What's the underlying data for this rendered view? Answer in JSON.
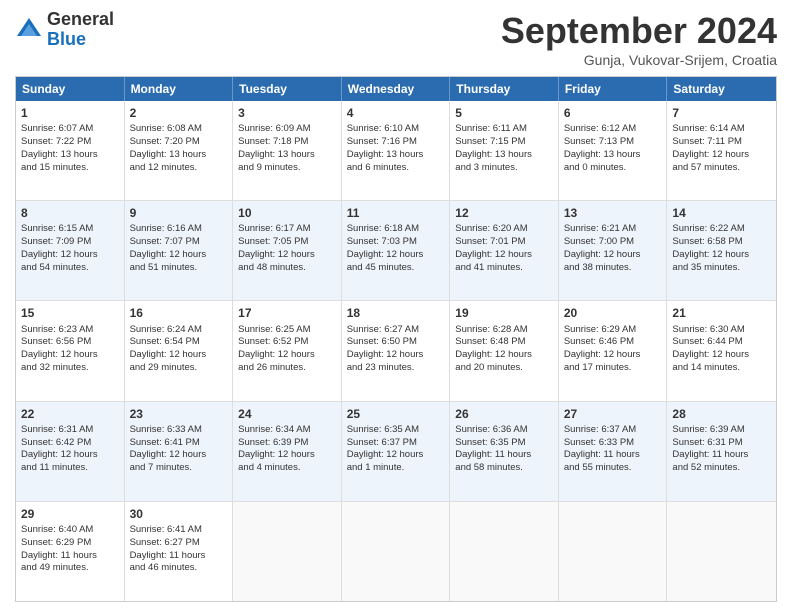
{
  "logo": {
    "general": "General",
    "blue": "Blue"
  },
  "title": "September 2024",
  "subtitle": "Gunja, Vukovar-Srijem, Croatia",
  "days": [
    "Sunday",
    "Monday",
    "Tuesday",
    "Wednesday",
    "Thursday",
    "Friday",
    "Saturday"
  ],
  "rows": [
    [
      {
        "day": "1",
        "lines": [
          "Sunrise: 6:07 AM",
          "Sunset: 7:22 PM",
          "Daylight: 13 hours",
          "and 15 minutes."
        ]
      },
      {
        "day": "2",
        "lines": [
          "Sunrise: 6:08 AM",
          "Sunset: 7:20 PM",
          "Daylight: 13 hours",
          "and 12 minutes."
        ]
      },
      {
        "day": "3",
        "lines": [
          "Sunrise: 6:09 AM",
          "Sunset: 7:18 PM",
          "Daylight: 13 hours",
          "and 9 minutes."
        ]
      },
      {
        "day": "4",
        "lines": [
          "Sunrise: 6:10 AM",
          "Sunset: 7:16 PM",
          "Daylight: 13 hours",
          "and 6 minutes."
        ]
      },
      {
        "day": "5",
        "lines": [
          "Sunrise: 6:11 AM",
          "Sunset: 7:15 PM",
          "Daylight: 13 hours",
          "and 3 minutes."
        ]
      },
      {
        "day": "6",
        "lines": [
          "Sunrise: 6:12 AM",
          "Sunset: 7:13 PM",
          "Daylight: 13 hours",
          "and 0 minutes."
        ]
      },
      {
        "day": "7",
        "lines": [
          "Sunrise: 6:14 AM",
          "Sunset: 7:11 PM",
          "Daylight: 12 hours",
          "and 57 minutes."
        ]
      }
    ],
    [
      {
        "day": "8",
        "lines": [
          "Sunrise: 6:15 AM",
          "Sunset: 7:09 PM",
          "Daylight: 12 hours",
          "and 54 minutes."
        ]
      },
      {
        "day": "9",
        "lines": [
          "Sunrise: 6:16 AM",
          "Sunset: 7:07 PM",
          "Daylight: 12 hours",
          "and 51 minutes."
        ]
      },
      {
        "day": "10",
        "lines": [
          "Sunrise: 6:17 AM",
          "Sunset: 7:05 PM",
          "Daylight: 12 hours",
          "and 48 minutes."
        ]
      },
      {
        "day": "11",
        "lines": [
          "Sunrise: 6:18 AM",
          "Sunset: 7:03 PM",
          "Daylight: 12 hours",
          "and 45 minutes."
        ]
      },
      {
        "day": "12",
        "lines": [
          "Sunrise: 6:20 AM",
          "Sunset: 7:01 PM",
          "Daylight: 12 hours",
          "and 41 minutes."
        ]
      },
      {
        "day": "13",
        "lines": [
          "Sunrise: 6:21 AM",
          "Sunset: 7:00 PM",
          "Daylight: 12 hours",
          "and 38 minutes."
        ]
      },
      {
        "day": "14",
        "lines": [
          "Sunrise: 6:22 AM",
          "Sunset: 6:58 PM",
          "Daylight: 12 hours",
          "and 35 minutes."
        ]
      }
    ],
    [
      {
        "day": "15",
        "lines": [
          "Sunrise: 6:23 AM",
          "Sunset: 6:56 PM",
          "Daylight: 12 hours",
          "and 32 minutes."
        ]
      },
      {
        "day": "16",
        "lines": [
          "Sunrise: 6:24 AM",
          "Sunset: 6:54 PM",
          "Daylight: 12 hours",
          "and 29 minutes."
        ]
      },
      {
        "day": "17",
        "lines": [
          "Sunrise: 6:25 AM",
          "Sunset: 6:52 PM",
          "Daylight: 12 hours",
          "and 26 minutes."
        ]
      },
      {
        "day": "18",
        "lines": [
          "Sunrise: 6:27 AM",
          "Sunset: 6:50 PM",
          "Daylight: 12 hours",
          "and 23 minutes."
        ]
      },
      {
        "day": "19",
        "lines": [
          "Sunrise: 6:28 AM",
          "Sunset: 6:48 PM",
          "Daylight: 12 hours",
          "and 20 minutes."
        ]
      },
      {
        "day": "20",
        "lines": [
          "Sunrise: 6:29 AM",
          "Sunset: 6:46 PM",
          "Daylight: 12 hours",
          "and 17 minutes."
        ]
      },
      {
        "day": "21",
        "lines": [
          "Sunrise: 6:30 AM",
          "Sunset: 6:44 PM",
          "Daylight: 12 hours",
          "and 14 minutes."
        ]
      }
    ],
    [
      {
        "day": "22",
        "lines": [
          "Sunrise: 6:31 AM",
          "Sunset: 6:42 PM",
          "Daylight: 12 hours",
          "and 11 minutes."
        ]
      },
      {
        "day": "23",
        "lines": [
          "Sunrise: 6:33 AM",
          "Sunset: 6:41 PM",
          "Daylight: 12 hours",
          "and 7 minutes."
        ]
      },
      {
        "day": "24",
        "lines": [
          "Sunrise: 6:34 AM",
          "Sunset: 6:39 PM",
          "Daylight: 12 hours",
          "and 4 minutes."
        ]
      },
      {
        "day": "25",
        "lines": [
          "Sunrise: 6:35 AM",
          "Sunset: 6:37 PM",
          "Daylight: 12 hours",
          "and 1 minute."
        ]
      },
      {
        "day": "26",
        "lines": [
          "Sunrise: 6:36 AM",
          "Sunset: 6:35 PM",
          "Daylight: 11 hours",
          "and 58 minutes."
        ]
      },
      {
        "day": "27",
        "lines": [
          "Sunrise: 6:37 AM",
          "Sunset: 6:33 PM",
          "Daylight: 11 hours",
          "and 55 minutes."
        ]
      },
      {
        "day": "28",
        "lines": [
          "Sunrise: 6:39 AM",
          "Sunset: 6:31 PM",
          "Daylight: 11 hours",
          "and 52 minutes."
        ]
      }
    ],
    [
      {
        "day": "29",
        "lines": [
          "Sunrise: 6:40 AM",
          "Sunset: 6:29 PM",
          "Daylight: 11 hours",
          "and 49 minutes."
        ]
      },
      {
        "day": "30",
        "lines": [
          "Sunrise: 6:41 AM",
          "Sunset: 6:27 PM",
          "Daylight: 11 hours",
          "and 46 minutes."
        ]
      },
      {
        "day": "",
        "lines": []
      },
      {
        "day": "",
        "lines": []
      },
      {
        "day": "",
        "lines": []
      },
      {
        "day": "",
        "lines": []
      },
      {
        "day": "",
        "lines": []
      }
    ]
  ]
}
